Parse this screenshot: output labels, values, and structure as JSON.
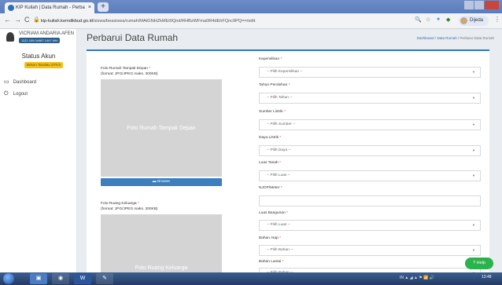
{
  "browser": {
    "tab_title": "KIP Kuliah | Data Rumah - Perba",
    "tab_close": "×",
    "new_tab": "+",
    "url_host": "kip-kuliah.kemdikbud.go.id",
    "url_path": "/siswa/beasiswa/rumah/MAtGNHZkMEt0Qnd/RHBzWFma0R4dEhFQnc9PQ==/edit",
    "profile_name": "Dijeda",
    "nav_back": "←",
    "nav_forward": "→",
    "nav_reload": "C",
    "lock": "🔒",
    "zoom_icon": "🔍",
    "star_icon": "☆",
    "menu": "⋮"
  },
  "sidebar": {
    "user_name": "VICRIAM ANDARIA AFEN",
    "user_nim": "1121.109.04487.1447.094",
    "status_title": "Status Akun",
    "status_badge": "Belum Tandatu DTKS",
    "items": [
      {
        "label": "Dashboard",
        "icon": "▭"
      },
      {
        "label": "Logout",
        "icon": "⏻"
      }
    ]
  },
  "page": {
    "title": "Perbarui Data Rumah",
    "breadcrumb_dashboard": "Dashboard",
    "breadcrumb_sep1": " / ",
    "breadcrumb_data_rumah": "Data Rumah",
    "breadcrumb_sep2": " / ",
    "breadcrumb_current": "Perbarui Data Rumah"
  },
  "photos": {
    "front_label": "Foto Rumah Tampak Depan ",
    "front_hint": "(format: JPG/JPEG maks. 300KB)",
    "front_placeholder": "Foto Rumah Tampak Depan",
    "browse_label": "Browse",
    "family_label": "Foto Ruang Keluarga ",
    "family_hint": "(format: JPG/JPEG maks. 300KB)",
    "family_placeholder": "Foto Ruang Keluarga"
  },
  "form": {
    "kepemilikan_label": "Kepemilikan ",
    "kepemilikan_value": "-- Pilih Kepemilikan --",
    "tahun_label": "Tahun Perolehan ",
    "tahun_value": "-- Pilih Tahun --",
    "sumber_label": "Sumber Listrik ",
    "sumber_value": "-- Pilih Sumber --",
    "daya_label": "Daya Listrik ",
    "daya_value": "-- Pilih Daya --",
    "luas_tanah_label": "Luas Tanah ",
    "luas_tanah_value": "-- Pilih Luas --",
    "njop_label": "NJOP/Meter ",
    "luas_bangunan_label": "Luas Bangunan ",
    "luas_bangunan_value": "-- Pilih Luas --",
    "atap_label": "Bahan Atap ",
    "atap_value": "-- Pilih Bahan --",
    "lantai_label": "Bahan Lantai ",
    "lantai_value": "-- Pilih Bahan --",
    "required_mark": "*"
  },
  "help_button": "Help",
  "taskbar": {
    "tray_text": "IN  ▲  ◢  ▲  ⚑  📶  🔊",
    "clock": "13:48"
  },
  "colors": {
    "accent": "#2f78bd",
    "browse": "#3b7fbf",
    "badge": "#f3c11b",
    "help": "#2bb24c"
  }
}
